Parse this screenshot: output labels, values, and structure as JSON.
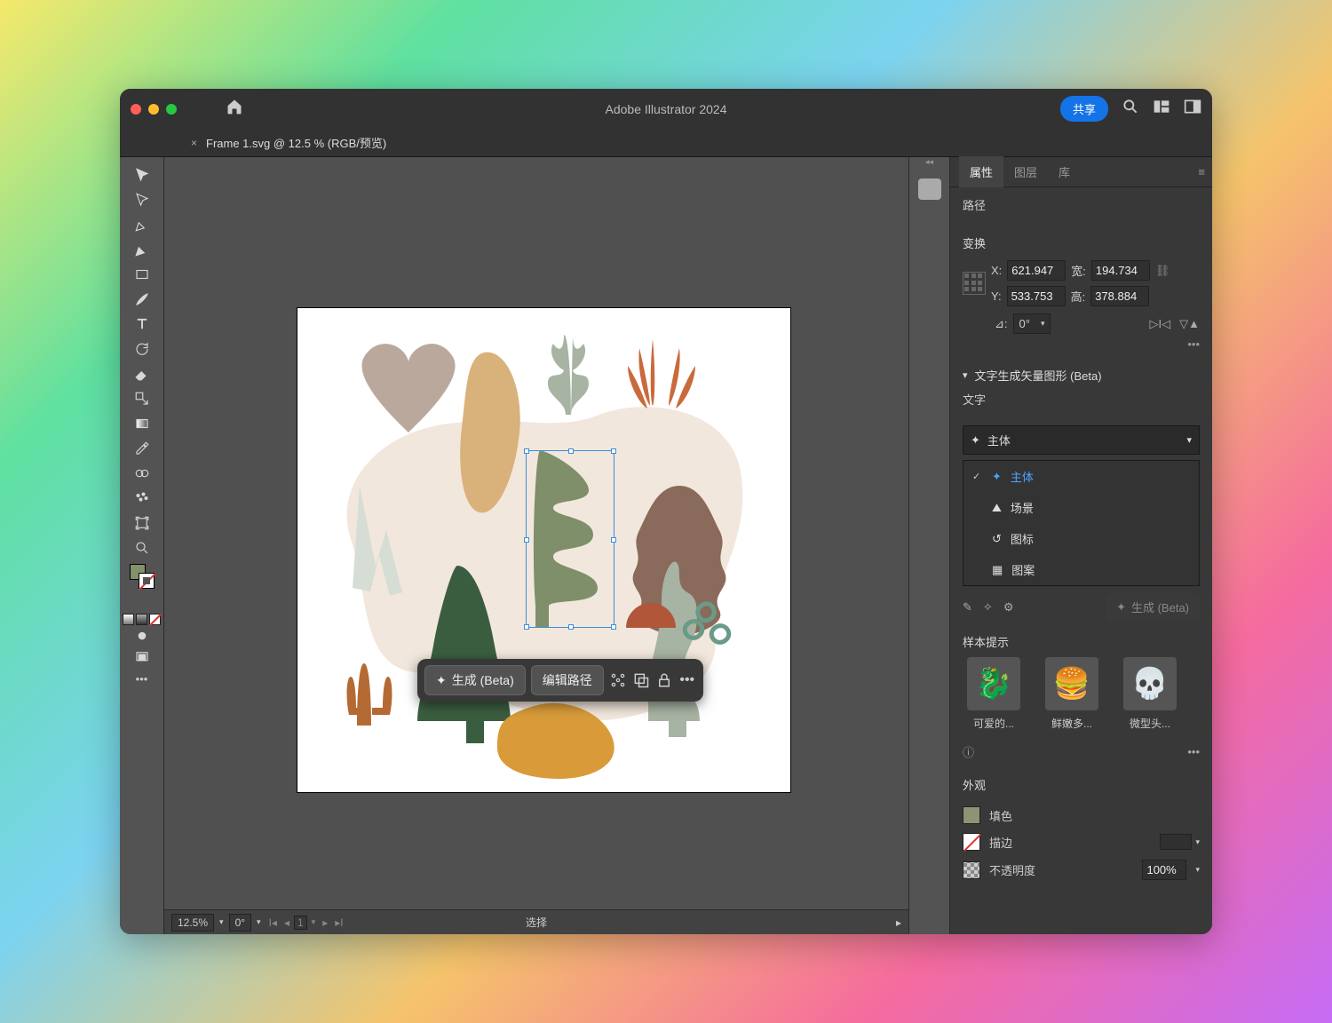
{
  "title": "Adobe Illustrator 2024",
  "share": "共享",
  "tab": {
    "close": "×",
    "label": "Frame 1.svg @ 12.5 % (RGB/预览)"
  },
  "context_bar": {
    "generate": "生成 (Beta)",
    "edit_path": "编辑路径"
  },
  "statusbar": {
    "zoom": "12.5%",
    "rotation": "0°",
    "page": "1",
    "mode": "选择"
  },
  "panels": {
    "tabs": {
      "properties": "属性",
      "layers": "图层",
      "libraries": "库"
    },
    "object_type": "路径",
    "transform": {
      "heading": "变换",
      "x_label": "X:",
      "x": "621.947",
      "y_label": "Y:",
      "y": "533.753",
      "w_label": "宽:",
      "w": "194.734",
      "h_label": "高:",
      "h": "378.884",
      "angle_label": "⊿:",
      "angle": "0°"
    },
    "textgen": {
      "heading": "文字生成矢量图形 (Beta)",
      "sub": "文字",
      "selected": "主体",
      "options": [
        "主体",
        "场景",
        "图标",
        "图案"
      ],
      "generate_btn": "生成 (Beta)"
    },
    "samples": {
      "heading": "样本提示",
      "items": [
        "可爱的...",
        "鲜嫩多...",
        "微型头..."
      ]
    },
    "appearance": {
      "heading": "外观",
      "fill": "填色",
      "stroke": "描边",
      "opacity_label": "不透明度",
      "opacity": "100%"
    }
  }
}
